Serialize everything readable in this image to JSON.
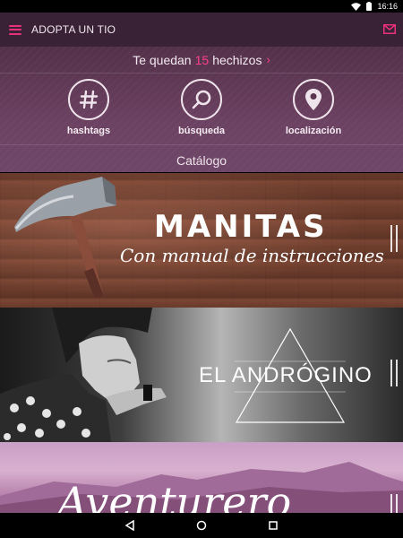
{
  "status_bar": {
    "time": "16:16"
  },
  "app_bar": {
    "title": "ADOPTA UN TIO"
  },
  "spells": {
    "prefix": "Te quedan",
    "count": "15",
    "suffix": "hechizos",
    "chevron": "›"
  },
  "features": [
    {
      "label": "hashtags",
      "icon": "hashtag-icon"
    },
    {
      "label": "búsqueda",
      "icon": "search-icon"
    },
    {
      "label": "localización",
      "icon": "location-pin-icon"
    }
  ],
  "catalog": {
    "title": "Catálogo",
    "cards": [
      {
        "title": "MANITAS",
        "subtitle": "Con manual de instrucciones"
      },
      {
        "title": "EL ANDRÓGINO"
      },
      {
        "title": "Aventurero"
      }
    ]
  },
  "colors": {
    "accent": "#e8317a",
    "app_bar": "#3a2236"
  }
}
